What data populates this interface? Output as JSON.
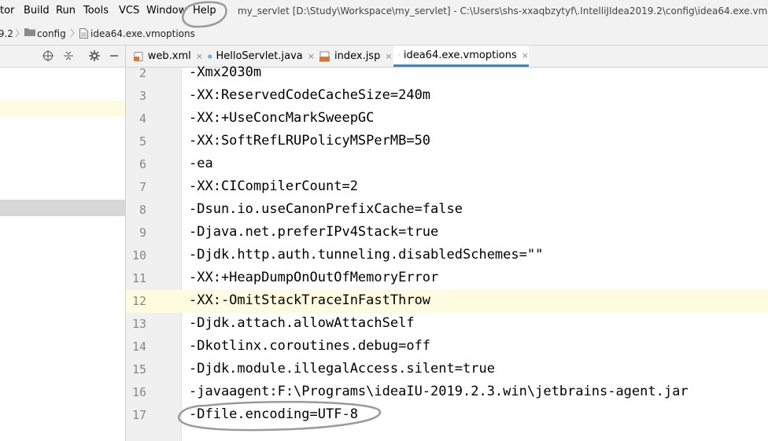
{
  "menu": {
    "items": [
      "tor",
      "Build",
      "Run",
      "Tools",
      "VCS",
      "Window",
      "Help"
    ],
    "window_title": "my_servlet [D:\\Study\\Workspace\\my_servlet] - C:\\Users\\shs-xxaqbzytyf\\.IntelliJIdea2019.2\\config\\idea64.exe.vmoptions"
  },
  "breadcrumb": {
    "parts": [
      ".9.2",
      "config",
      "idea64.exe.vmoptions"
    ]
  },
  "panel_toolbar": {
    "icons": [
      "target-icon",
      "collapse-icon",
      "gear-icon",
      "minimize-icon"
    ]
  },
  "tabs": [
    {
      "label": "web.xml",
      "icon": "xml-file-icon",
      "active": false
    },
    {
      "label": "HelloServlet.java",
      "icon": "java-class-icon",
      "active": false
    },
    {
      "label": "index.jsp",
      "icon": "jsp-file-icon",
      "active": false
    },
    {
      "label": "idea64.exe.vmoptions",
      "icon": "text-file-icon",
      "active": true
    }
  ],
  "close_glyph": "×",
  "editor": {
    "current_line": 12,
    "lines": [
      {
        "num": "2",
        "text": "-Xmx2030m"
      },
      {
        "num": "3",
        "text": "-XX:ReservedCodeCacheSize=240m"
      },
      {
        "num": "4",
        "text": "-XX:+UseConcMarkSweepGC"
      },
      {
        "num": "5",
        "text": "-XX:SoftRefLRUPolicyMSPerMB=50"
      },
      {
        "num": "6",
        "text": "-ea"
      },
      {
        "num": "7",
        "text": "-XX:CICompilerCount=2"
      },
      {
        "num": "8",
        "text": "-Dsun.io.useCanonPrefixCache=false"
      },
      {
        "num": "9",
        "text": "-Djava.net.preferIPv4Stack=true"
      },
      {
        "num": "10",
        "text": "-Djdk.http.auth.tunneling.disabledSchemes=\"\""
      },
      {
        "num": "11",
        "text": "-XX:+HeapDumpOnOutOfMemoryError"
      },
      {
        "num": "12",
        "text": "-XX:-OmitStackTraceInFastThrow"
      },
      {
        "num": "13",
        "text": "-Djdk.attach.allowAttachSelf"
      },
      {
        "num": "14",
        "text": "-Dkotlinx.coroutines.debug=off"
      },
      {
        "num": "15",
        "text": "-Djdk.module.illegalAccess.silent=true"
      },
      {
        "num": "16",
        "text": "-javaagent:F:\\Programs\\ideaIU-2019.2.3.win\\jetbrains-agent.jar"
      },
      {
        "num": "17",
        "text": "-Dfile.encoding=UTF-8"
      }
    ]
  },
  "colors": {
    "tab_active_underline": "#4083c9",
    "current_line_bg": "#fffbe0",
    "annotation_stroke": "#9a9a9a"
  }
}
